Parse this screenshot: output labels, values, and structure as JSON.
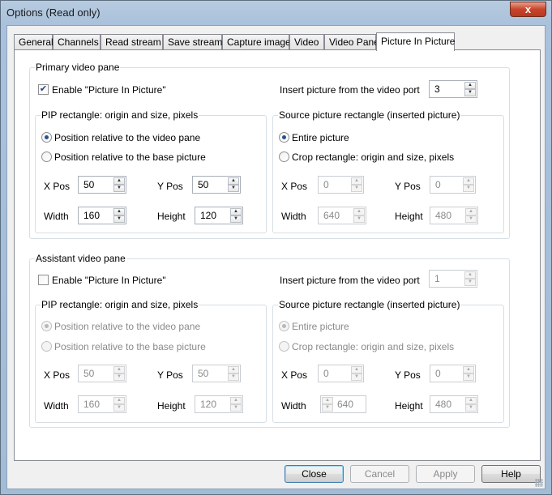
{
  "window": {
    "title": "Options (Read only)",
    "close_glyph": "x"
  },
  "tabs": [
    {
      "label": "General"
    },
    {
      "label": "Channels"
    },
    {
      "label": "Read stream"
    },
    {
      "label": "Save stream"
    },
    {
      "label": "Capture image"
    },
    {
      "label": "Video"
    },
    {
      "label": "Video Pane"
    },
    {
      "label": "Picture In Picture"
    }
  ],
  "primary": {
    "title": "Primary video pane",
    "enable_label": "Enable \"Picture In Picture\"",
    "enable_checked": true,
    "port_label": "Insert picture from the video port",
    "port_value": "3",
    "pip": {
      "title": "PIP rectangle: origin and size, pixels",
      "radio1": "Position relative to the video pane",
      "radio2": "Position relative to the base picture",
      "xpos_label": "X Pos",
      "xpos": "50",
      "ypos_label": "Y Pos",
      "ypos": "50",
      "width_label": "Width",
      "width": "160",
      "height_label": "Height",
      "height": "120"
    },
    "src": {
      "title": "Source picture rectangle (inserted picture)",
      "radio1": "Entire picture",
      "radio2": "Crop rectangle: origin and size, pixels",
      "xpos_label": "X Pos",
      "xpos": "0",
      "ypos_label": "Y Pos",
      "ypos": "0",
      "width_label": "Width",
      "width": "640",
      "height_label": "Height",
      "height": "480"
    }
  },
  "assistant": {
    "title": "Assistant video pane",
    "enable_label": "Enable \"Picture In Picture\"",
    "enable_checked": false,
    "port_label": "Insert picture from the video port",
    "port_value": "1",
    "pip": {
      "title": "PIP rectangle: origin and size, pixels",
      "radio1": "Position relative to the video pane",
      "radio2": "Position relative to the base picture",
      "xpos_label": "X Pos",
      "xpos": "50",
      "ypos_label": "Y Pos",
      "ypos": "50",
      "width_label": "Width",
      "width": "160",
      "height_label": "Height",
      "height": "120"
    },
    "src": {
      "title": "Source picture rectangle (inserted picture)",
      "radio1": "Entire picture",
      "radio2": "Crop rectangle: origin and size, pixels",
      "xpos_label": "X Pos",
      "xpos": "0",
      "ypos_label": "Y Pos",
      "ypos": "0",
      "width_label": "Width",
      "width": "640",
      "height_label": "Height",
      "height": "480"
    }
  },
  "buttons": {
    "close": "Close",
    "cancel": "Cancel",
    "apply": "Apply",
    "help": "Help"
  }
}
